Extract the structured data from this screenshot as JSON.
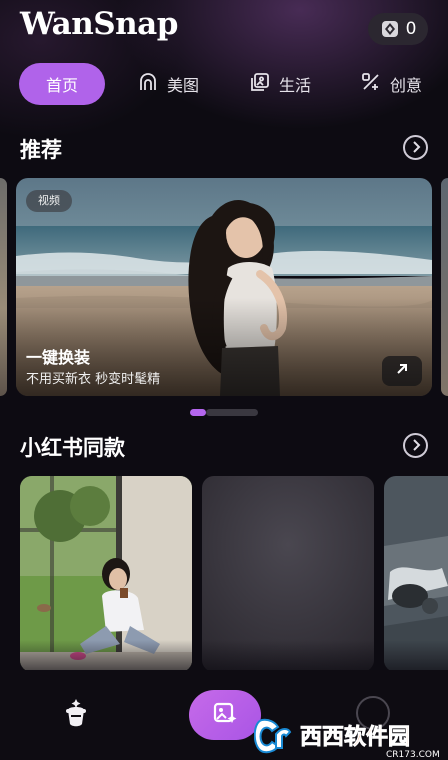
{
  "header": {
    "app_title": "WanSnap",
    "coin_icon": "gem-coin-icon",
    "coin_count": "0"
  },
  "tabs": [
    {
      "label": "首页",
      "icon": null,
      "active": true
    },
    {
      "label": "美图",
      "icon": "face-outline-icon",
      "active": false
    },
    {
      "label": "生活",
      "icon": "photo-stack-icon",
      "active": false
    },
    {
      "label": "创意",
      "icon": "magic-wand-icon",
      "active": false
    }
  ],
  "recommend": {
    "title": "推荐",
    "hero": {
      "tag": "视频",
      "title": "一键换装",
      "subtitle": "不用买新衣 秒变时髦精"
    },
    "carousel_position": 1,
    "carousel_count": 4
  },
  "xiaohongshu": {
    "title": "小红书同款"
  },
  "bottom_nav": {
    "home_icon": "magic-hat-icon",
    "create_icon": "image-sparkle-icon",
    "profile_icon": "avatar-ring-icon"
  },
  "watermark": {
    "text": "西西软件园",
    "domain": "CR173.COM"
  },
  "colors": {
    "accent": "#b063ea",
    "background": "#0d0b12"
  }
}
